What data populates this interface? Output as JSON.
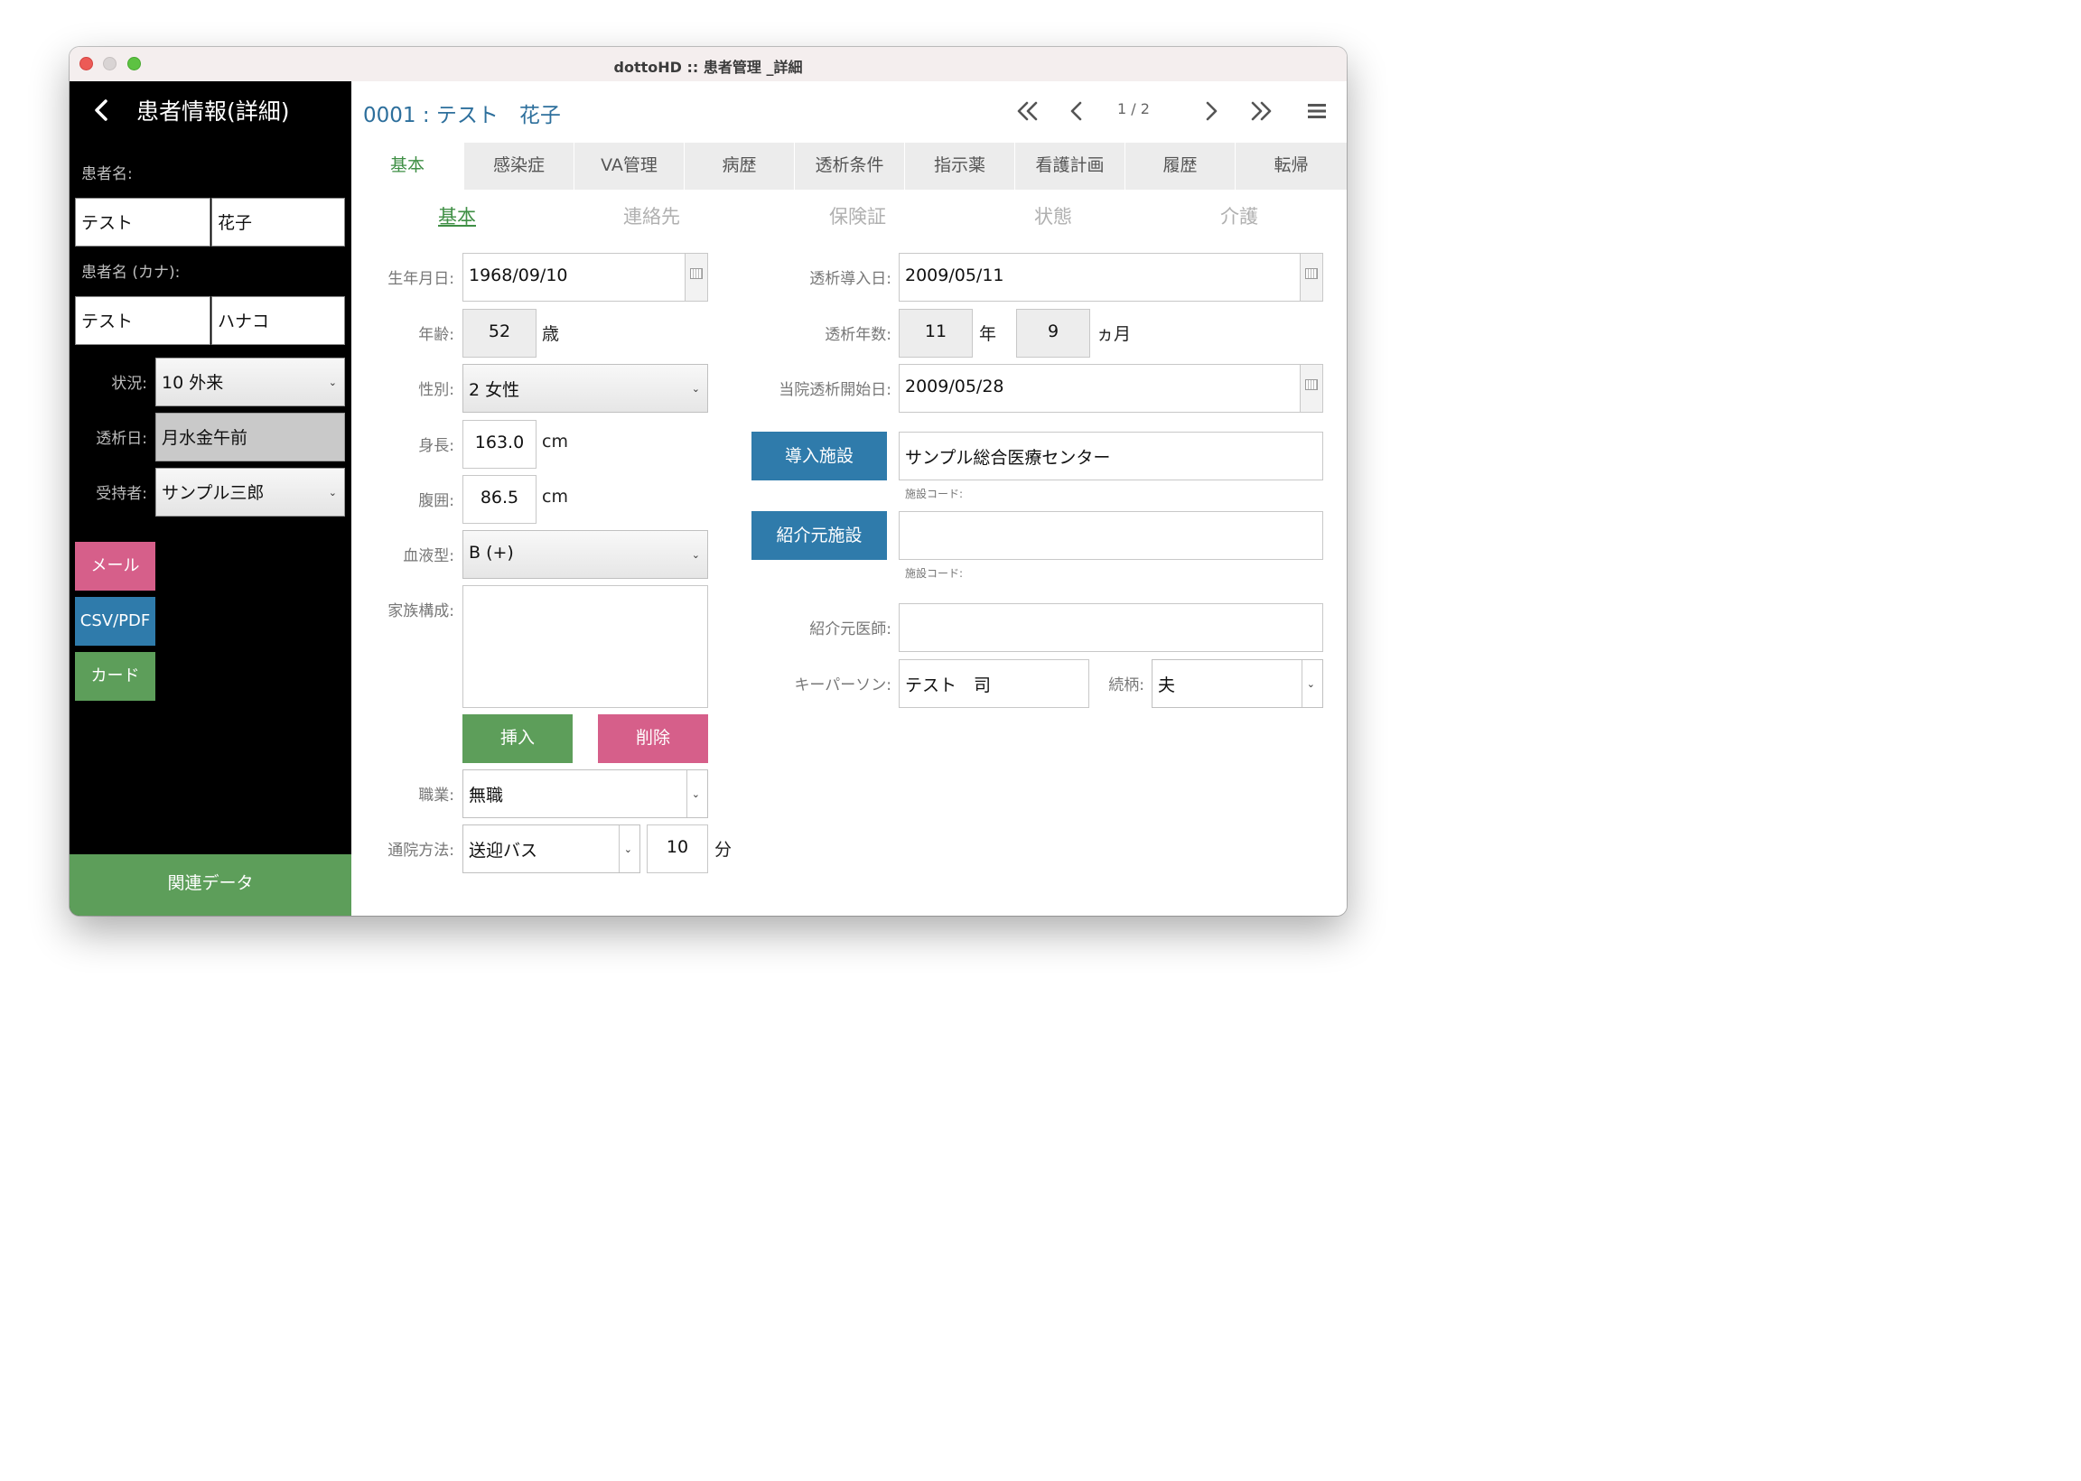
{
  "window": {
    "title": "dottoHD :: 患者管理 _詳細"
  },
  "sidebar": {
    "title": "患者情報(詳細)",
    "name_label": "患者名:",
    "name_last": "テスト",
    "name_first": "花子",
    "kana_label": "患者名 (カナ):",
    "kana_last": "テスト",
    "kana_first": "ハナコ",
    "status_label": "状況:",
    "status_value": "10 外来",
    "dialysis_day_label": "透析日:",
    "dialysis_day_value": "月水金午前",
    "receiver_label": "受持者:",
    "receiver_value": "サンプル三郎",
    "mail_button": "メール",
    "csv_button": "CSV/PDF",
    "card_button": "カード",
    "related_button": "関連データ"
  },
  "colors": {
    "mail": "#d65f8a",
    "csv": "#2f7bab",
    "card": "#5d9e5a",
    "insert": "#5d9e5a",
    "delete": "#d65f8a",
    "accent_green": "#3f8f45",
    "title_blue": "#2d6f9c"
  },
  "header": {
    "patient_title": "0001 : テスト　花子",
    "page_indicator": "1 / 2",
    "icons": [
      "first-page-icon",
      "prev-page-icon",
      "next-page-icon",
      "last-page-icon",
      "menu-icon"
    ]
  },
  "tabs": [
    "基本",
    "感染症",
    "VA管理",
    "病歴",
    "透析条件",
    "指示薬",
    "看護計画",
    "履歴",
    "転帰"
  ],
  "active_tab": "基本",
  "subtabs": [
    "基本",
    "連絡先",
    "保険証",
    "状態",
    "介護"
  ],
  "active_subtab": "基本",
  "form": {
    "birthday_label": "生年月日:",
    "birthday": "1968/09/10",
    "age_label": "年齢:",
    "age": "52",
    "age_unit": "歳",
    "sex_label": "性別:",
    "sex": "2 女性",
    "height_label": "身長:",
    "height": "163.0",
    "height_unit": "cm",
    "waist_label": "腹囲:",
    "waist": "86.5",
    "waist_unit": "cm",
    "blood_label": "血液型:",
    "blood": "B (+)",
    "family_label": "家族構成:",
    "family": "",
    "insert_button": "挿入",
    "delete_button": "削除",
    "job_label": "職業:",
    "job": "無職",
    "commute_label": "通院方法:",
    "commute": "送迎バス",
    "commute_minutes": "10",
    "commute_unit": "分",
    "intro_date_label": "透析導入日:",
    "intro_date": "2009/05/11",
    "years_label": "透析年数:",
    "years": "11",
    "years_unit": "年",
    "months": "9",
    "months_unit": "ヵ月",
    "start_date_label": "当院透析開始日:",
    "start_date": "2009/05/28",
    "intro_facility_button": "導入施設",
    "intro_facility": "サンプル総合医療センター",
    "facility_code_note_1": "施設コード:",
    "referral_facility_button": "紹介元施設",
    "referral_facility": "",
    "facility_code_note_2": "施設コード:",
    "referral_doctor_label": "紹介元医師:",
    "referral_doctor": "",
    "keyperson_label": "キーパーソン:",
    "keyperson": "テスト　司",
    "relation_label": "続柄:",
    "relation": "夫"
  }
}
